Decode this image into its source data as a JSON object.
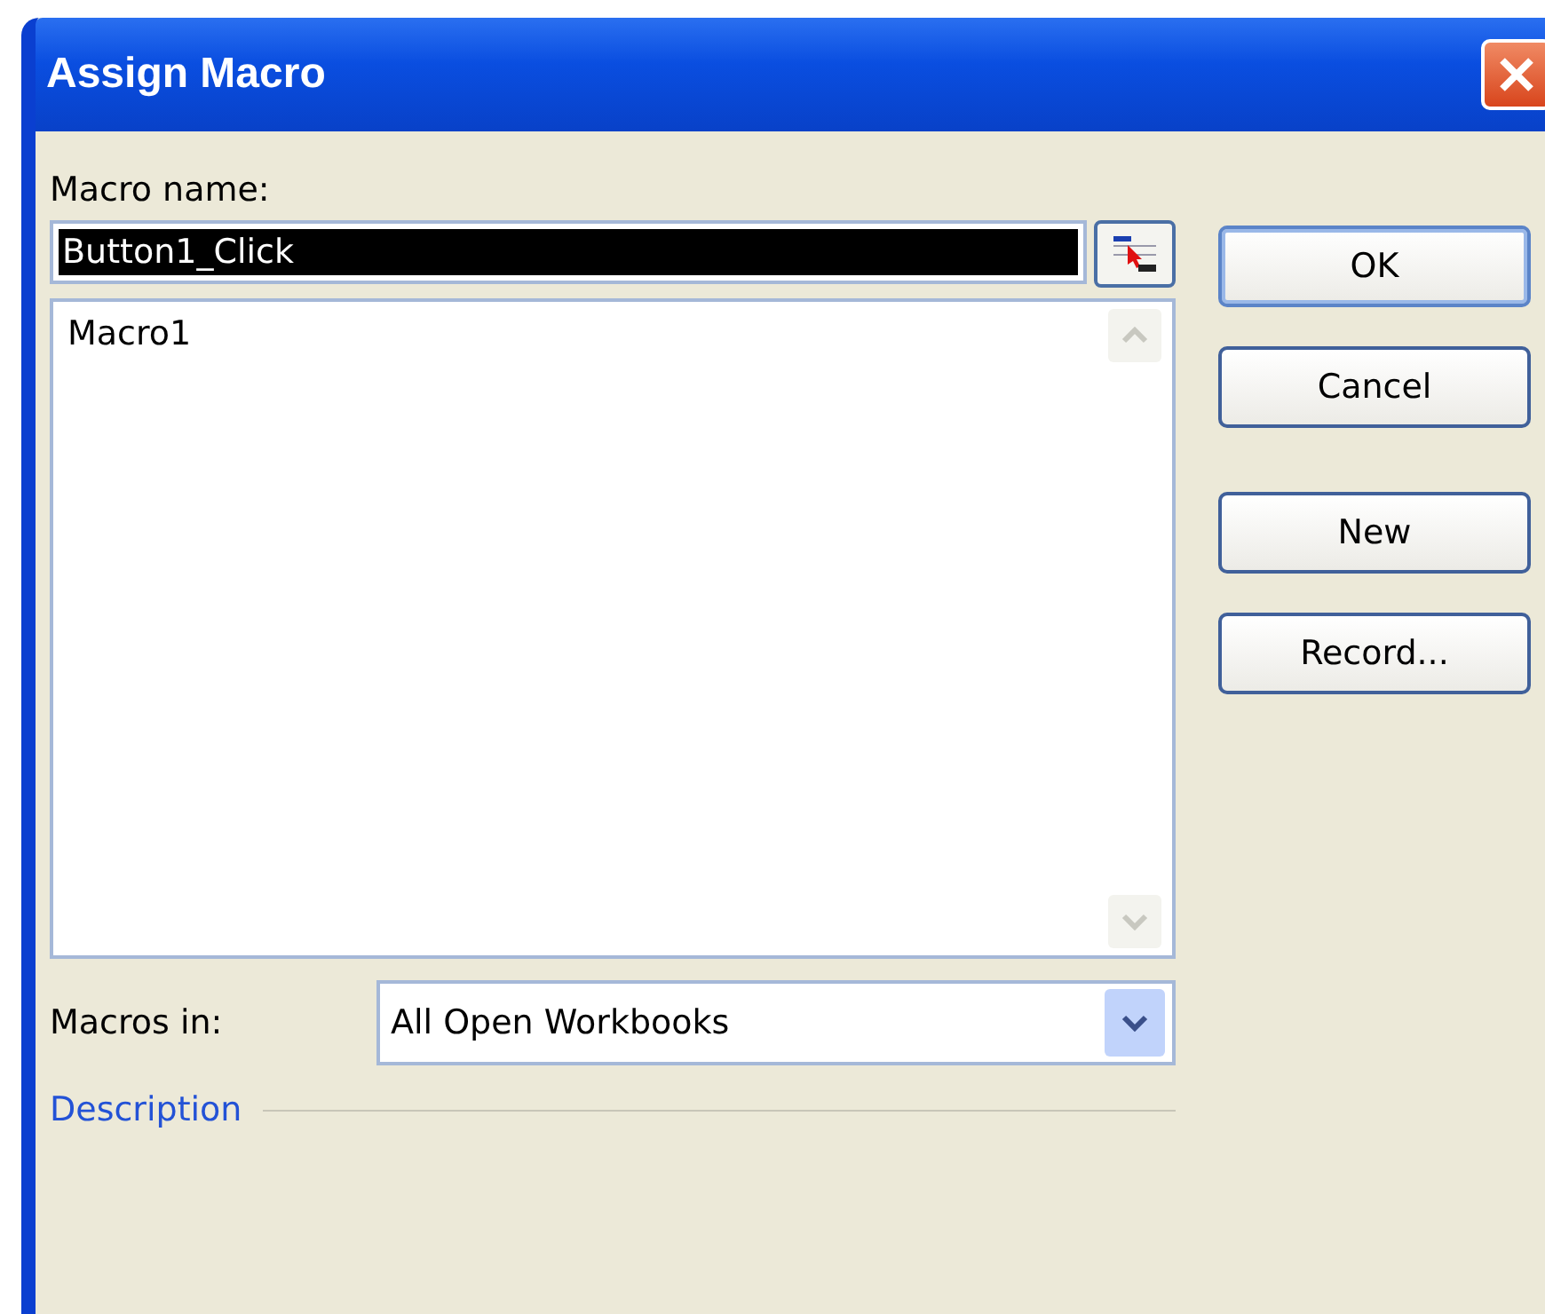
{
  "window": {
    "title": "Assign Macro"
  },
  "macro_name": {
    "label": "Macro name:",
    "value": "Button1_Click",
    "selected": true
  },
  "macro_list": {
    "items": [
      {
        "label": "Macro1",
        "selected": false
      }
    ]
  },
  "buttons": [
    "OK",
    "Cancel",
    "New",
    "Record..."
  ],
  "macros_in": {
    "label": "Macros in:",
    "value": "All Open Workbooks"
  },
  "description": {
    "label": "Description"
  }
}
